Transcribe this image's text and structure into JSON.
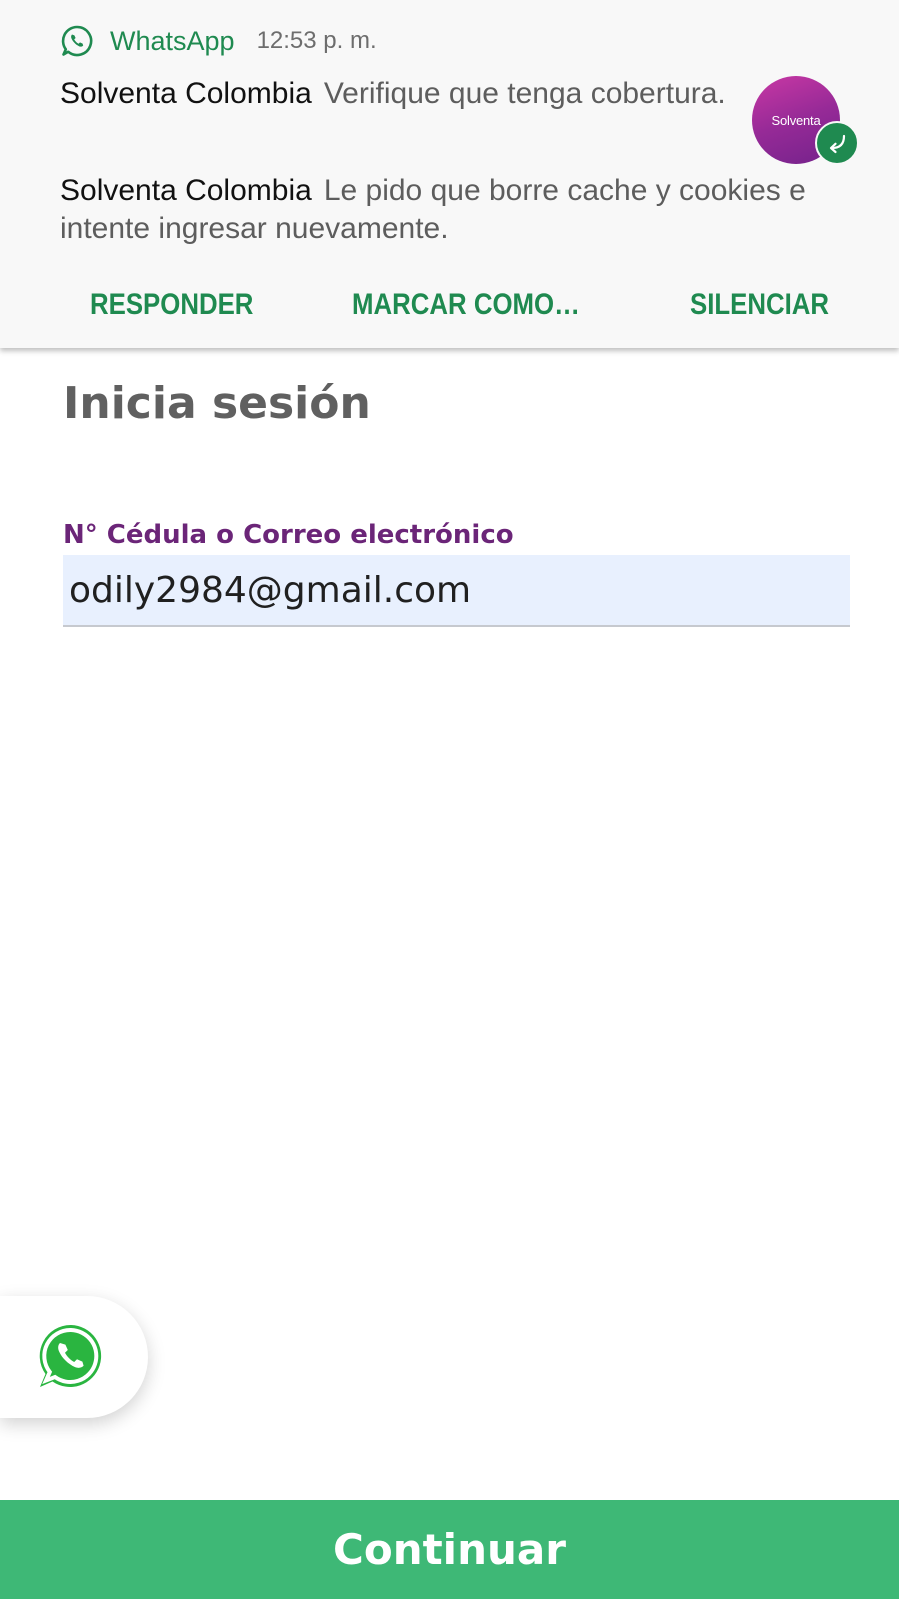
{
  "notification": {
    "app_name": "WhatsApp",
    "time": "12:53 p. m.",
    "icon": "whatsapp-icon",
    "messages": [
      {
        "sender": "Solventa Colombia",
        "text": "Verifique que tenga cobertura."
      },
      {
        "sender": "Solventa Colombia",
        "text": "Le pido que borre cache y cookies e intente ingresar nuevamente."
      }
    ],
    "avatar_text": "Solventa",
    "actions": [
      "RESPONDER",
      "MARCAR COMO…",
      "SILENCIAR"
    ],
    "accent_color": "#1f8a50"
  },
  "login": {
    "title": "Inicia sesión",
    "field_label": "N° Cédula o Correo electrónico",
    "field_value": "odily2984@gmail.com",
    "label_color": "#6b2578"
  },
  "floating_button": {
    "icon": "whatsapp-icon",
    "color": "#2ab540"
  },
  "continue_button": {
    "label": "Continuar",
    "color": "#3eb876"
  }
}
